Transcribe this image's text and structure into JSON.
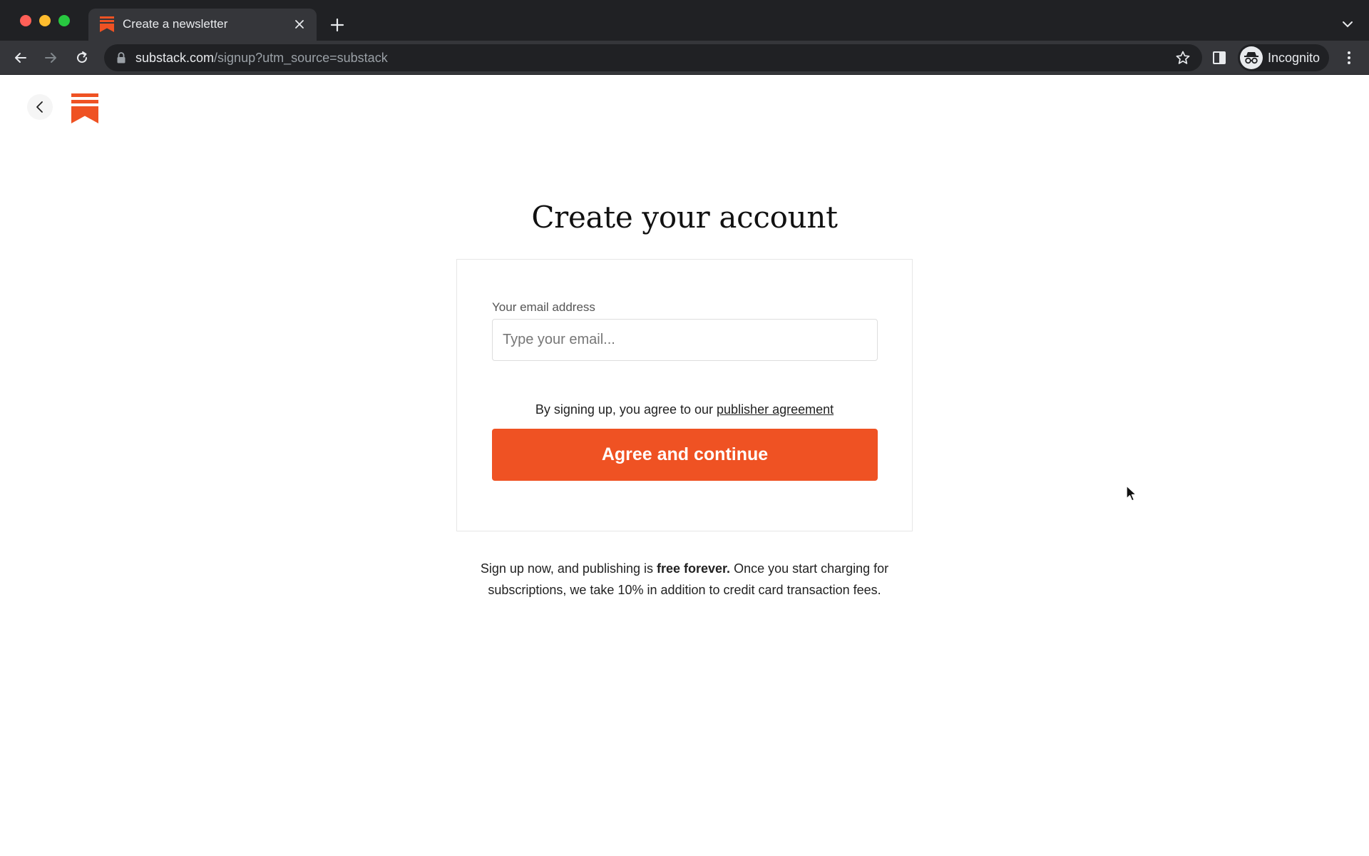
{
  "browser": {
    "tab": {
      "title": "Create a newsletter",
      "favicon": "substack-logo-icon"
    },
    "address": {
      "host": "substack.com",
      "path": "/signup?utm_source=substack"
    },
    "profile_label": "Incognito"
  },
  "page": {
    "heading": "Create your account",
    "form": {
      "email_label": "Your email address",
      "email_placeholder": "Type your email...",
      "email_value": "",
      "agreement_prefix": "By signing up, you agree to our ",
      "agreement_link": "publisher agreement",
      "submit_label": "Agree and continue"
    },
    "footer": {
      "line_start": "Sign up now, and publishing is ",
      "emphasis": "free forever.",
      "line_end": " Once you start charging for subscriptions, we take 10% in addition to credit card transaction fees."
    }
  },
  "colors": {
    "brand": "#ef5223",
    "chrome_dark": "#202124",
    "chrome_tab": "#35363a"
  }
}
